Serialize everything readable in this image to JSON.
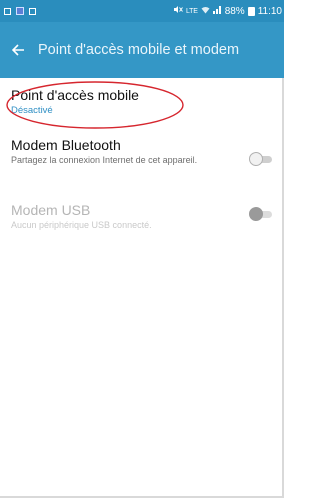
{
  "status_bar": {
    "network_small": "LTE",
    "signal": ".ıl",
    "battery_percent": "88%",
    "time": "11:10",
    "icons": [
      "gallery-icon",
      "notification-p-icon",
      "sim-icon",
      "mute-icon",
      "wifi-icon",
      "signal-icon",
      "battery-icon"
    ]
  },
  "app_bar": {
    "title": "Point d'accès mobile et modem",
    "color": "#3497c6"
  },
  "items": [
    {
      "title": "Point d'accès mobile",
      "subtitle": "Désactivé",
      "has_toggle": false,
      "enabled": true
    },
    {
      "title": "Modem Bluetooth",
      "subtitle": "Partagez la connexion Internet de cet appareil.",
      "has_toggle": true,
      "toggle_on": false,
      "enabled": true
    },
    {
      "title": "Modem USB",
      "subtitle": "Aucun périphérique USB connecté.",
      "has_toggle": true,
      "toggle_on": false,
      "enabled": false
    }
  ],
  "annotation": {
    "shape": "ellipse",
    "color": "#d6262e",
    "target": "Point d'accès mobile"
  }
}
